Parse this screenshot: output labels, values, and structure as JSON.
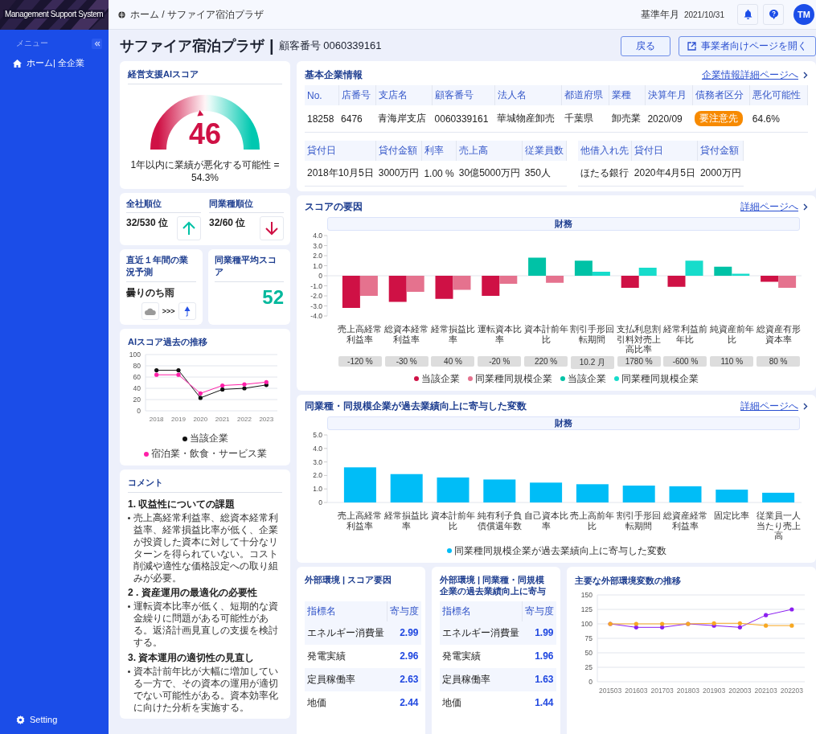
{
  "sidebar": {
    "brand": "Management Support System",
    "menu_label": "メニュー",
    "items": [
      {
        "label": "ホーム| 全企業"
      }
    ],
    "footer": "Setting"
  },
  "header": {
    "breadcrumb": "ホーム / サファイア宿泊プラザ",
    "date_label": "基準年月",
    "date": "2021/10/31",
    "avatar": "TM"
  },
  "page": {
    "title": "サファイア宿泊プラザ",
    "separator": "|",
    "customer": "顧客番号 0060339161",
    "buttons": [
      {
        "label": "戻る",
        "kind": "plain"
      },
      {
        "label": "事業者向けページを開く",
        "kind": "external"
      }
    ]
  },
  "ai_score": {
    "title": "経営支援AIスコア",
    "score": "46",
    "note": "1年以内に業績が悪化する可能性 = 54.3%"
  },
  "ranks": [
    {
      "title": "全社順位",
      "value": "32/530 位",
      "kind": "up"
    },
    {
      "title": "同業種順位",
      "value": "32/60 位",
      "kind": "down"
    }
  ],
  "forecast": {
    "title": "直近１年間の業況予測",
    "text": "曇りのち雨",
    "weather": [
      {
        "kind": "cloud"
      },
      {
        "kind": "umbrella"
      }
    ],
    "arrow": ">>>"
  },
  "industry_score": {
    "title": "同業種平均スコア",
    "value": "52"
  },
  "history": {
    "title": "AIスコア過去の推移",
    "chart_data": {
      "type": "line",
      "grid": true,
      "legend": true,
      "x": [
        "2018",
        "2019",
        "2020",
        "2021",
        "2022",
        "2023"
      ],
      "ylim": [
        0,
        100
      ],
      "yticks": [
        0,
        20,
        40,
        60,
        80,
        100
      ],
      "series": [
        {
          "name": "当該企業",
          "color": "#111111",
          "values": [
            72,
            72,
            23,
            38,
            40,
            46
          ]
        },
        {
          "name": "宿泊業・飲食・サービス業",
          "color": "#ff1fa8",
          "values": [
            64,
            64,
            31,
            45,
            47,
            51
          ]
        }
      ]
    }
  },
  "comments": {
    "title": "コメント",
    "sections": [
      {
        "heading": "1. 収益性についての課題",
        "bullets": [
          "売上高経常利益率、総資本経常利益率、経常損益比率が低く、企業が投資した資本に対して十分なリターンを得られていない。コスト削減や適性な価格設定への取り組みが必要。"
        ]
      },
      {
        "heading": "2 . 資産運用の最適化の必要性",
        "bullets": [
          "運転資本比率が低く、短期的な資金繰りに問題がある可能性がある。返済計画見直しの支援を検討する。"
        ]
      },
      {
        "heading": "3.  資本運用の適切性の見直し",
        "bullets": [
          "資本計前年比が大幅に増加している一方で、その資本の運用が適切でない可能性がある。資本効率化に向けた分析を実施する。"
        ]
      }
    ]
  },
  "company": {
    "title": "基本企業情報",
    "link": "企業情報詳細ページへ",
    "tables": [
      {
        "columns": [
          "No.",
          "店番号",
          "支店名",
          "顧客番号",
          "法人名",
          "都道府県",
          "業種",
          "決算年月",
          "債務者区分",
          "悪化可能性"
        ],
        "rows": [
          [
            "18258",
            "6476",
            "青海岸支店",
            "0060339161",
            "華城物産卸売",
            "千葉県",
            "卸売業",
            "2020/09",
            {
              "text": "要注意先",
              "kind": "badge"
            },
            "64.6%"
          ]
        ]
      },
      {
        "columns": [
          "貸付日",
          "貸付金額",
          "利率",
          "売上高",
          "従業員数"
        ],
        "rows": [
          [
            "2018年10月5日",
            "3000万円",
            "1.00 %",
            "30億5000万円",
            "350人"
          ]
        ]
      },
      {
        "columns": [
          "他借入れ先",
          "貸付日",
          "貸付金額"
        ],
        "rows": [
          [
            "ほたる銀行",
            "2020年4月5日",
            "2000万円"
          ]
        ]
      }
    ]
  },
  "factors": {
    "title": "スコアの要因",
    "link": "詳細ページへ",
    "band": "財務",
    "chart_data": {
      "type": "bar",
      "categories": [
        "売上高経常利益率",
        "総資本経常利益率",
        "経常損益比率",
        "運転資本比率",
        "資本計前年比",
        "割引手形回転期間",
        "支払利息割引料対売上高比率",
        "経常利益前年比",
        "純資産前年比",
        "総資産有形資本率"
      ],
      "ylim": [
        -4,
        4
      ],
      "legend": true,
      "yticks": [
        {
          "value": 4,
          "label": "4.0"
        },
        {
          "value": 3,
          "label": "3.0"
        },
        {
          "value": 2,
          "label": "2.0"
        },
        {
          "value": 1,
          "label": "1.0"
        },
        {
          "value": 0,
          "label": "0"
        },
        {
          "value": -1,
          "label": "-1.0"
        },
        {
          "value": -2,
          "label": "-2.0"
        },
        {
          "value": -3,
          "label": "-3.0"
        },
        {
          "value": -4,
          "label": "-4.0"
        }
      ],
      "series": [
        {
          "name": "当該企業",
          "color": "#cf1145",
          "values": [
            -3.2,
            -2.6,
            -2.3,
            -2.0,
            null,
            null,
            -1.2,
            -1.1,
            null,
            -0.6
          ]
        },
        {
          "name": "同業種同規模企業",
          "color": "#e5728e",
          "values": [
            -2.0,
            -1.6,
            -1.4,
            -0.8,
            -0.7,
            null,
            null,
            null,
            null,
            -1.2
          ]
        },
        {
          "name": "当該企業",
          "color": "#00c2a6",
          "values": [
            null,
            null,
            null,
            null,
            1.8,
            1.5,
            null,
            null,
            0.9,
            null
          ]
        },
        {
          "name": "同業種同規模企業",
          "color": "#17dccb",
          "values": [
            null,
            null,
            null,
            null,
            null,
            0.4,
            0.8,
            1.5,
            0.2,
            null
          ]
        }
      ]
    },
    "indicator_values": [
      "-120 %",
      "-30 %",
      "40 %",
      "-20 %",
      "220 %",
      "10.2 月",
      "1780 %",
      "-600 %",
      "110 %",
      "80 %"
    ]
  },
  "contributors": {
    "title": "同業種・同規模企業が過去業績向上に寄与した変数",
    "link": "詳細ページへ",
    "band": "財務",
    "chart_data": {
      "type": "bar",
      "categories": [
        "売上高経常利益率",
        "経常損益比率",
        "資本計前年比",
        "純有利子負債償還年数",
        "自己資本比率",
        "売上高前年比",
        "割引手形回転期間",
        "総資産経常利益率",
        "固定比率",
        "従業員一人当たり売上高"
      ],
      "ylim": [
        0,
        5
      ],
      "legend": true,
      "yticks": [
        {
          "value": 0,
          "label": "0"
        },
        {
          "value": 1,
          "label": "1.0"
        },
        {
          "value": 2,
          "label": "2.0"
        },
        {
          "value": 3,
          "label": "3.0"
        },
        {
          "value": 4,
          "label": "4.0"
        },
        {
          "value": 5,
          "label": "5.0"
        }
      ],
      "series": [
        {
          "name": "同業種同規模企業が過去業績向上に寄与した変数",
          "color": "#00bdf7",
          "values": [
            2.6,
            2.1,
            1.85,
            1.7,
            1.47,
            1.35,
            1.25,
            1.2,
            0.95,
            0.72
          ]
        }
      ]
    }
  },
  "external_tables": [
    {
      "title": "外部環境 | スコア要因",
      "columns": [
        "指標名",
        "寄与度"
      ],
      "rows": [
        [
          "エネルギー消費量",
          "2.99"
        ],
        [
          "発電実績",
          "2.96"
        ],
        [
          "定員稼働率",
          "2.63"
        ],
        [
          "地価",
          "2.44"
        ]
      ]
    },
    {
      "title": "外部環境 | 同業種・同規模企業の過去業績向上に寄与",
      "columns": [
        "指標名",
        "寄与度"
      ],
      "rows": [
        [
          "エネルギー消費量",
          "1.99"
        ],
        [
          "発電実績",
          "1.96"
        ],
        [
          "定員稼働率",
          "1.63"
        ],
        [
          "地価",
          "1.44"
        ]
      ]
    }
  ],
  "external_trend": {
    "title": "主要な外部環境変数の推移",
    "chart_data": {
      "type": "line",
      "grid": true,
      "x": [
        "201503",
        "201603",
        "201703",
        "201803",
        "201903",
        "202003",
        "202103",
        "202203"
      ],
      "ylim": [
        0,
        150
      ],
      "yticks": [
        0,
        25,
        50,
        75,
        100,
        125,
        150
      ],
      "series": [
        {
          "color": "#8b1ff0",
          "values": [
            100,
            94,
            94,
            100,
            97,
            94,
            115,
            125
          ]
        },
        {
          "color": "#f7a823",
          "values": [
            100,
            100,
            100,
            100,
            101,
            101,
            97,
            97
          ]
        }
      ]
    }
  }
}
